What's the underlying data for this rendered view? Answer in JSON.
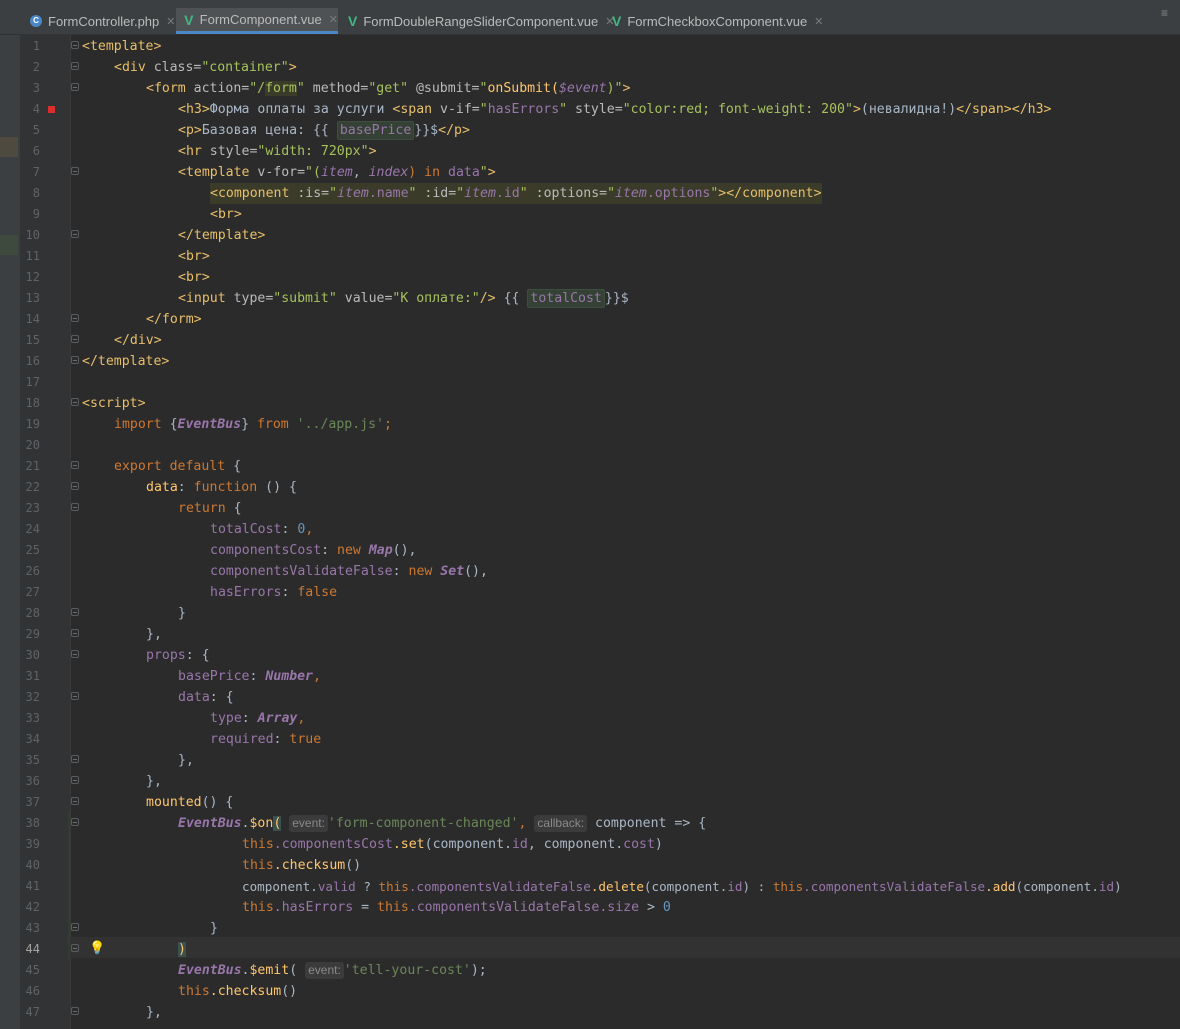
{
  "tabs": [
    {
      "icon": "php-file-icon",
      "label": "FormController.php",
      "active": false
    },
    {
      "icon": "vue-file-icon",
      "label": "FormComponent.vue",
      "active": true
    },
    {
      "icon": "vue-file-icon",
      "label": "FormDoubleRangeSliderComponent.vue",
      "active": false
    },
    {
      "icon": "vue-file-icon",
      "label": "FormCheckboxComponent.vue",
      "active": false
    }
  ],
  "editor": {
    "current_line": 44,
    "breakpoint_line": 4,
    "bulb_line": 44,
    "line_numbers": [
      "1",
      "2",
      "3",
      "4",
      "5",
      "6",
      "7",
      "8",
      "9",
      "10",
      "11",
      "12",
      "13",
      "14",
      "15",
      "16",
      "17",
      "18",
      "19",
      "20",
      "21",
      "22",
      "23",
      "24",
      "25",
      "26",
      "27",
      "28",
      "29",
      "30",
      "31",
      "32",
      "33",
      "34",
      "35",
      "36",
      "37",
      "38",
      "39",
      "40",
      "41",
      "42",
      "43",
      "44",
      "45",
      "46",
      "47"
    ],
    "text": {
      "l1_tag": "<template>",
      "l2_open": "<div ",
      "l2_attr": "class=",
      "l2_val": "\"container\"",
      "l2_close": ">",
      "l3_open": "<form ",
      "l3_attr1": "action=",
      "l3_val1a": "\"/",
      "l3_val1b": "form",
      "l3_val1c": "\" ",
      "l3_attr2": "method=",
      "l3_val2": "\"get\" ",
      "l3_attr3": "@submit=",
      "l3_val3a": "\"",
      "l3_val3b": "onSubmit(",
      "l3_val3c": "$event",
      "l3_val3d": ")\"",
      "l3_close": ">",
      "l4_h3": "<h3>",
      "l4_text": "Форма оплаты за услуги ",
      "l4_span": "<span ",
      "l4_attr1": "v-if=",
      "l4_val1a": "\"",
      "l4_val1b": "hasErrors",
      "l4_val1c": "\" ",
      "l4_attr2": "style=",
      "l4_val2": "\"color:red; font-weight: 200\"",
      "l4_gt": ">",
      "l4_text2": "(невалидна!)",
      "l4_close": "</span></h3>",
      "l5_p": "<p>",
      "l5_text": "Базовая цена: {{",
      "l5_ref": "basePrice",
      "l5_text2": "}}$",
      "l5_close": "</p>",
      "l6_open": "<hr ",
      "l6_attr": "style=",
      "l6_val": "\"width: 720px\"",
      "l6_close": ">",
      "l7_open": "<template ",
      "l7_attr": "v-for=",
      "l7_val1": "\"(",
      "l7_item": "item",
      "l7_comma": ", ",
      "l7_index": "index",
      "l7_in": ") in ",
      "l7_data": "data",
      "l7_val2": "\"",
      "l7_close": ">",
      "l8_open": "<component ",
      "l8_attr1": ":is=",
      "l8_v1a": "\"",
      "l8_v1b": "item",
      "l8_v1c": ".name",
      "l8_v1d": "\" ",
      "l8_attr2": ":id=",
      "l8_v2a": "\"",
      "l8_v2b": "item",
      "l8_v2c": ".id",
      "l8_v2d": "\" ",
      "l8_attr3": ":options=",
      "l8_v3a": "\"",
      "l8_v3b": "item",
      "l8_v3c": ".options",
      "l8_v3d": "\"",
      "l8_close": "></component>",
      "l9": "<br>",
      "l10": "</template>",
      "l11": "<br>",
      "l12": "<br>",
      "l13_open": "<input ",
      "l13_attr1": "type=",
      "l13_val1": "\"submit\" ",
      "l13_attr2": "value=",
      "l13_val2": "\"К оплате:\"",
      "l13_close": "/>",
      "l13_text": " {{",
      "l13_ref": "totalCost",
      "l13_text2": "}}$",
      "l14": "</form>",
      "l15": "</div>",
      "l16": "</template>",
      "l18": "<script>",
      "l19_import": "import ",
      "l19_b1": "{",
      "l19_cls": "EventBus",
      "l19_b2": "} ",
      "l19_from": "from ",
      "l19_path": "'../app.js'",
      "l19_semi": ";",
      "l21_export": "export default ",
      "l21_brace": "{",
      "l22_data": "data",
      "l22_colon": ": ",
      "l22_fn": "function ",
      "l22_rest": "() {",
      "l23_ret": "return ",
      "l23_brace": "{",
      "l24_key": "totalCost",
      "l24_colon": ": ",
      "l24_num": "0",
      "l24_comma": ",",
      "l25_key": "componentsCost",
      "l25_colon": ": ",
      "l25_new": "new ",
      "l25_cls": "Map",
      "l25_rest": "(),",
      "l26_key": "componentsValidateFalse",
      "l26_colon": ": ",
      "l26_new": "new ",
      "l26_cls": "Set",
      "l26_rest": "(),",
      "l27_key": "hasErrors",
      "l27_colon": ": ",
      "l27_val": "false",
      "l28": "}",
      "l29": "},",
      "l30_key": "props",
      "l30_rest": ": {",
      "l31_key": "basePrice",
      "l31_colon": ": ",
      "l31_type": "Number",
      "l31_comma": ",",
      "l32_key": "data",
      "l32_rest": ": {",
      "l33_key": "type",
      "l33_colon": ": ",
      "l33_type": "Array",
      "l33_comma": ",",
      "l34_key": "required",
      "l34_colon": ": ",
      "l34_val": "true",
      "l35": "},",
      "l36": "},",
      "l37_fn": "mounted",
      "l37_rest": "() {",
      "l38_cls": "EventBus",
      "l38_dot": ".",
      "l38_fn": "$on",
      "l38_paren": "(",
      "l38_hint1": "event:",
      "l38_str": "'form-component-changed'",
      "l38_comma": ",",
      "l38_hint2": "callback:",
      "l38_rest": " component => {",
      "l39_this": "this",
      "l39_p": ".componentsCost",
      "l39_m": ".set",
      "l39_rest": "(component.",
      "l39_id": "id",
      "l39_rest2": ", component.",
      "l39_cost": "cost",
      "l39_end": ")",
      "l40_this": "this",
      "l40_m": ".checksum",
      "l40_rest": "()",
      "l41_a": "component.",
      "l41_valid": "valid",
      "l41_b": " ? ",
      "l41_this1": "this",
      "l41_p1": ".componentsValidateFalse",
      "l41_m1": ".delete",
      "l41_c": "(component.",
      "l41_id1": "id",
      "l41_d": ") : ",
      "l41_this2": "this",
      "l41_p2": ".componentsValidateFalse",
      "l41_m2": ".add",
      "l41_e": "(component.",
      "l41_id2": "id",
      "l41_f": ")",
      "l42_this": "this",
      "l42_p": ".hasErrors",
      "l42_eq": " = ",
      "l42_this2": "this",
      "l42_p2": ".componentsValidateFalse",
      "l42_size": ".size",
      "l42_gt": " > ",
      "l42_num": "0",
      "l43": "}",
      "l44": ")",
      "l45_cls": "EventBus",
      "l45_dot": ".",
      "l45_fn": "$emit",
      "l45_paren": "(",
      "l45_hint": "event:",
      "l45_str": "'tell-your-cost'",
      "l45_end": ");",
      "l46_this": "this",
      "l46_m": ".checksum",
      "l46_rest": "()",
      "l47": "},"
    }
  },
  "colors": {
    "tag": "#e8bf6a",
    "string": "#a5c25c",
    "keyword": "#cc7832",
    "property": "#9876aa",
    "function": "#ffc66d",
    "number": "#6897bb",
    "background": "#2b2b2b"
  }
}
